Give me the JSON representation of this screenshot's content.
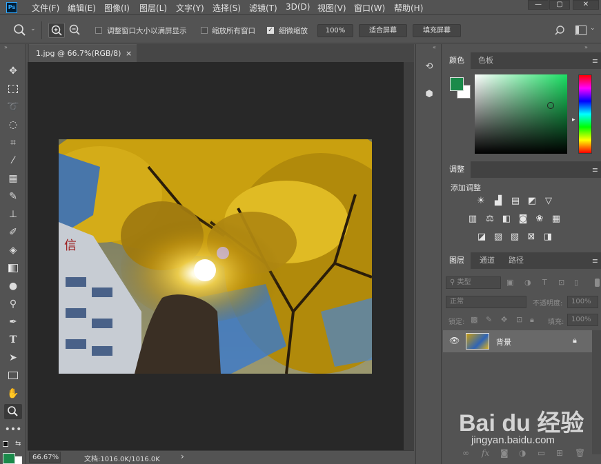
{
  "app": {
    "logo": "Ps"
  },
  "menubar": {
    "items": [
      "文件(F)",
      "编辑(E)",
      "图像(I)",
      "图层(L)",
      "文字(Y)",
      "选择(S)",
      "滤镜(T)",
      "3D(D)",
      "视图(V)",
      "窗口(W)",
      "帮助(H)"
    ],
    "window_controls": {
      "minimize": "—",
      "maximize": "▢",
      "close": "✕"
    }
  },
  "options": {
    "resize_windows_label": "调整窗口大小以满屏显示",
    "resize_windows_checked": false,
    "zoom_all_label": "缩放所有窗口",
    "zoom_all_checked": false,
    "scrubby_zoom_label": "细微缩放",
    "scrubby_zoom_checked": true,
    "percent_button": "100%",
    "fit_screen_button": "适合屏幕",
    "fill_screen_button": "填充屏幕"
  },
  "document": {
    "tab_title": "1.jpg @ 66.7%(RGB/8)",
    "tab_close": "×",
    "zoom": "66.67%",
    "doc_info": "文档:1016.0K/1016.0K",
    "status_arrow": "›"
  },
  "color_panel": {
    "tabs": [
      "颜色",
      "色板"
    ],
    "foreground": "#1a8a4a",
    "background": "#ffffff"
  },
  "adjustments_panel": {
    "title": "调整",
    "subtitle": "添加调整"
  },
  "layers_panel": {
    "tabs": [
      "图层",
      "通道",
      "路径"
    ],
    "filter_label": "类型",
    "blend_mode": "正常",
    "opacity_label": "不透明度:",
    "opacity_value": "100%",
    "lock_label": "锁定:",
    "fill_label": "填充:",
    "fill_value": "100%",
    "layers": [
      {
        "name": "背景",
        "visible": true,
        "locked": true
      }
    ]
  },
  "watermark": {
    "text": "Bai du 经验",
    "url": "jingyan.baidu.com"
  },
  "colors": {
    "ui_bg": "#535353",
    "canvas_bg": "#282828",
    "accent_fg": "#1a8a4a"
  }
}
